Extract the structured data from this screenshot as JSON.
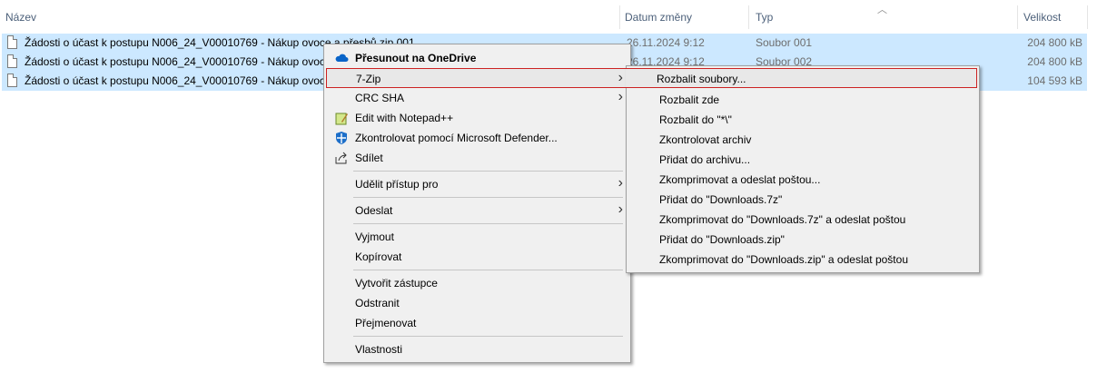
{
  "columns": {
    "name": "Název",
    "date": "Datum změny",
    "type": "Typ",
    "size": "Velikost"
  },
  "files": [
    {
      "name": "Žádosti o účast k postupu N006_24_V00010769 - Nákup ovoce a přesbů.zip.001",
      "date": "26.11.2024 9:12",
      "type": "Soubor 001",
      "size": "204 800 kB"
    },
    {
      "name": "Žádosti o účast k postupu N006_24_V00010769 - Nákup ovoce a",
      "date": "26.11.2024 9:12",
      "type": "Soubor 002",
      "size": "204 800 kB"
    },
    {
      "name": "Žádosti o účast k postupu N006_24_V00010769 - Nákup ovoce a",
      "date": "",
      "type": "",
      "size": "104 593 kB"
    }
  ],
  "context_menu": {
    "onedrive": "Přesunout na OneDrive",
    "zip": "7-Zip",
    "crc": "CRC SHA",
    "notepad": "Edit with Notepad++",
    "defender": "Zkontrolovat pomocí Microsoft Defender...",
    "share": "Sdílet",
    "grant": "Udělit přístup pro",
    "send": "Odeslat",
    "cut": "Vyjmout",
    "copy": "Kopírovat",
    "shortcut": "Vytvořit zástupce",
    "delete": "Odstranit",
    "rename": "Přejmenovat",
    "props": "Vlastnosti"
  },
  "zip_submenu": [
    "Rozbalit soubory...",
    "Rozbalit zde",
    "Rozbalit do \"*\\\"",
    "Zkontrolovat archiv",
    "Přidat do archivu...",
    "Zkomprimovat a odeslat poštou...",
    "Přidat do \"Downloads.7z\"",
    "Zkomprimovat do \"Downloads.7z\" a odeslat poštou",
    "Přidat do \"Downloads.zip\"",
    "Zkomprimovat do \"Downloads.zip\" a odeslat poštou"
  ],
  "colors": {
    "selection": "#cce8ff",
    "menu_bg": "#f0f0f0",
    "highlight_border": "#cc2222",
    "onedrive_blue": "#0a64c8"
  }
}
